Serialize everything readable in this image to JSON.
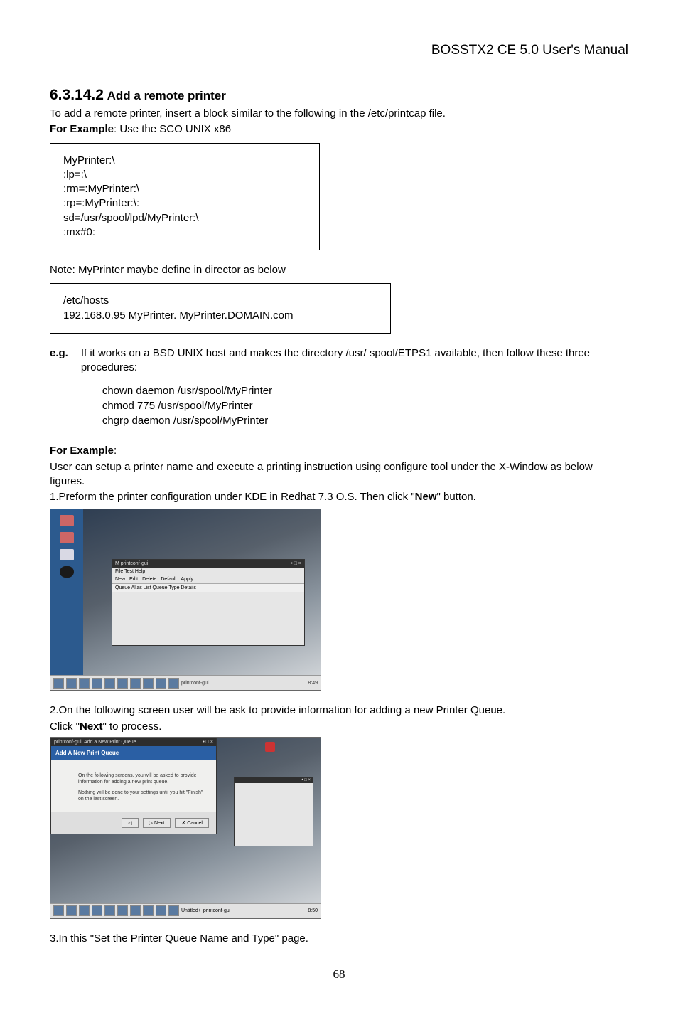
{
  "header": "BOSSTX2 CE 5.0 User's Manual",
  "section_number": "6.3.14.2",
  "section_title": "Add a remote printer",
  "intro": "To add a remote printer, insert a block similar to the following in the /etc/printcap file.",
  "for_example_label": "For Example",
  "example_intro": ": Use the SCO UNIX x86",
  "codebox1": "MyPrinter:\\\n:lp=:\\\n:rm=:MyPrinter:\\\n:rp=:MyPrinter:\\:\nsd=/usr/spool/lpd/MyPrinter:\\\n:mx#0:",
  "note_line": "Note: MyPrinter maybe define in director as below",
  "codebox2": "/etc/hosts\n192.168.0.95     MyPrinter.     MyPrinter.DOMAIN.com",
  "eg_label": "e.g.",
  "eg_text1": "If it works on a BSD UNIX host and makes the directory /usr/ spool/ETPS1 available, then follow these three procedures:",
  "eg_cmd1": "chown daemon /usr/spool/MyPrinter",
  "eg_cmd2": "chmod 775 /usr/spool/MyPrinter",
  "eg_cmd3": "chgrp daemon /usr/spool/MyPrinter",
  "example_block2": ":",
  "example2_line1": "User can setup a printer name and execute a printing instruction using configure tool under the X-Window as below figures.",
  "example2_line2a": "1.Preform the printer configuration under KDE in Redhat 7.3 O.S. Then click \"",
  "example2_bold": "New",
  "example2_line2b": "\" button.",
  "shot1": {
    "window_title": "M printconf-gui",
    "menubar": "File   Test   Help",
    "toolbar_new": "New",
    "toolbar_edit": "Edit",
    "toolbar_delete": "Delete",
    "toolbar_default": "Default",
    "toolbar_apply": "Apply",
    "cols": "Queue        Alias List          Queue Type  Details",
    "tasktab": "printconf-gui",
    "clock": "8:49"
  },
  "step2a": "2.On the following screen user will be ask to provide information for adding a new Printer Queue.",
  "step2b1": "Click \"",
  "step2b_bold": "Next",
  "step2b2": "\" to process.",
  "shot2": {
    "dtitle": "printconf-gui: Add a New Print Queue",
    "dheader": "Add A New Print Queue",
    "dbody1": "On the following screens, you will be asked to provide information for adding a new print queue.",
    "dbody2": "Nothing will be done to your settings until you hit \"Finish\" on the last screen.",
    "btn_back": "◁",
    "btn_next": "▷ Next",
    "btn_cancel": "✗ Cancel",
    "tasktab1": "Untitled+",
    "tasktab2": "printconf-gui",
    "clock": "8:50"
  },
  "step3": "3.In this \"Set the Printer Queue Name and Type\" page.",
  "page_number": "68"
}
